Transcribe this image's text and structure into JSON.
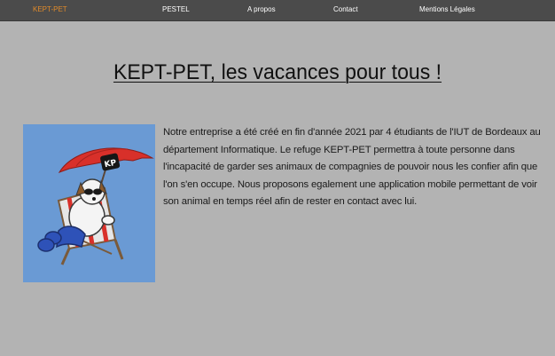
{
  "nav": {
    "brand": "KEPT-PET",
    "items": [
      {
        "label": "PESTEL"
      },
      {
        "label": "A propos"
      },
      {
        "label": "Contact"
      },
      {
        "label": "Mentions Légales"
      }
    ]
  },
  "main": {
    "title": "KEPT-PET, les vacances pour tous !",
    "intro": "Notre entreprise a été créé en fin d'année 2021 par 4 étudiants de l'IUT de Bordeaux au département Informatique. Le refuge KEPT-PET permettra à toute personne dans l'incapacité de garder ses animaux de compagnies de pouvoir nous les confier afin que l'on s'en occupe. Nous proposons egalement une application mobile permettant de voir son animal en temps réel afin de rester en contact avec lui.",
    "mascot": {
      "icon": "dog-on-beach-chair-logo",
      "umbrella_badge": "KP"
    }
  },
  "colors": {
    "navbar_bg": "#4b4b4b",
    "brand": "#e08a2a",
    "page_bg": "#b3b3b3",
    "mascot_bg": "#6a9ad4",
    "umbrella": "#d8302a"
  }
}
